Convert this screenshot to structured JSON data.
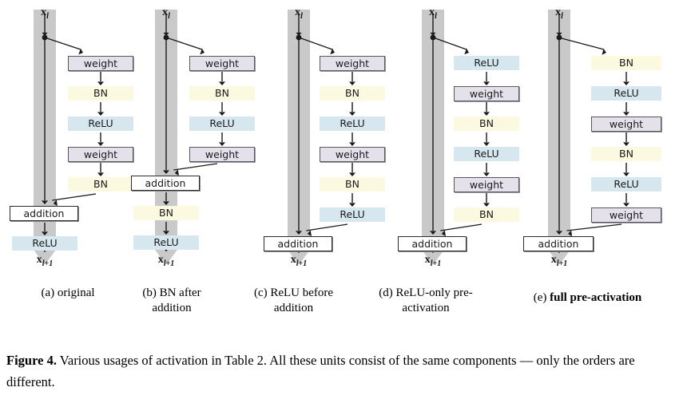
{
  "figure": {
    "label": "Figure 4.",
    "caption": "Various usages of activation in Table 2. All these units consist of the same components — only the orders are different.",
    "input_label": "x",
    "input_sub": "l",
    "output_label": "x",
    "output_sub": "l+1",
    "colors": {
      "shaft": "#c9c9c9",
      "weight_fill": "#e4e1ea",
      "weight_border": "#58565c",
      "bn_fill": "#fbf9e0",
      "relu_fill": "#d7e7ef",
      "addition_fill": "#ffffff",
      "addition_border": "#2b2b2b",
      "arrow": "#1a1a1a"
    }
  },
  "panels": [
    {
      "id": "a",
      "caption_prefix": "(a)",
      "caption_text": "original",
      "caption_bold": false,
      "branch_blocks": [
        {
          "type": "weight",
          "label": "weight"
        },
        {
          "type": "bn",
          "label": "BN"
        },
        {
          "type": "relu",
          "label": "ReLU"
        },
        {
          "type": "weight",
          "label": "weight"
        },
        {
          "type": "bn",
          "label": "BN"
        }
      ],
      "addition_label": "addition",
      "trunk_after_addition": [
        {
          "type": "relu",
          "label": "ReLU"
        }
      ]
    },
    {
      "id": "b",
      "caption_prefix": "(b)",
      "caption_text": "BN after addition",
      "caption_bold": false,
      "branch_blocks": [
        {
          "type": "weight",
          "label": "weight"
        },
        {
          "type": "bn",
          "label": "BN"
        },
        {
          "type": "relu",
          "label": "ReLU"
        },
        {
          "type": "weight",
          "label": "weight"
        }
      ],
      "addition_label": "addition",
      "trunk_after_addition": [
        {
          "type": "bn",
          "label": "BN"
        },
        {
          "type": "relu",
          "label": "ReLU"
        }
      ]
    },
    {
      "id": "c",
      "caption_prefix": "(c)",
      "caption_text": "ReLU before addition",
      "caption_bold": false,
      "branch_blocks": [
        {
          "type": "weight",
          "label": "weight"
        },
        {
          "type": "bn",
          "label": "BN"
        },
        {
          "type": "relu",
          "label": "ReLU"
        },
        {
          "type": "weight",
          "label": "weight"
        },
        {
          "type": "bn",
          "label": "BN"
        },
        {
          "type": "relu",
          "label": "ReLU"
        }
      ],
      "addition_label": "addition",
      "trunk_after_addition": []
    },
    {
      "id": "d",
      "caption_prefix": "(d)",
      "caption_text": "ReLU-only pre-activation",
      "caption_bold": false,
      "branch_blocks": [
        {
          "type": "relu",
          "label": "ReLU"
        },
        {
          "type": "weight",
          "label": "weight"
        },
        {
          "type": "bn",
          "label": "BN"
        },
        {
          "type": "relu",
          "label": "ReLU"
        },
        {
          "type": "weight",
          "label": "weight"
        },
        {
          "type": "bn",
          "label": "BN"
        }
      ],
      "addition_label": "addition",
      "trunk_after_addition": []
    },
    {
      "id": "e",
      "caption_prefix": "(e)",
      "caption_text": "full pre-activation",
      "caption_bold": true,
      "branch_blocks": [
        {
          "type": "bn",
          "label": "BN"
        },
        {
          "type": "relu",
          "label": "ReLU"
        },
        {
          "type": "weight",
          "label": "weight"
        },
        {
          "type": "bn",
          "label": "BN"
        },
        {
          "type": "relu",
          "label": "ReLU"
        },
        {
          "type": "weight",
          "label": "weight"
        }
      ],
      "addition_label": "addition",
      "trunk_after_addition": []
    }
  ]
}
